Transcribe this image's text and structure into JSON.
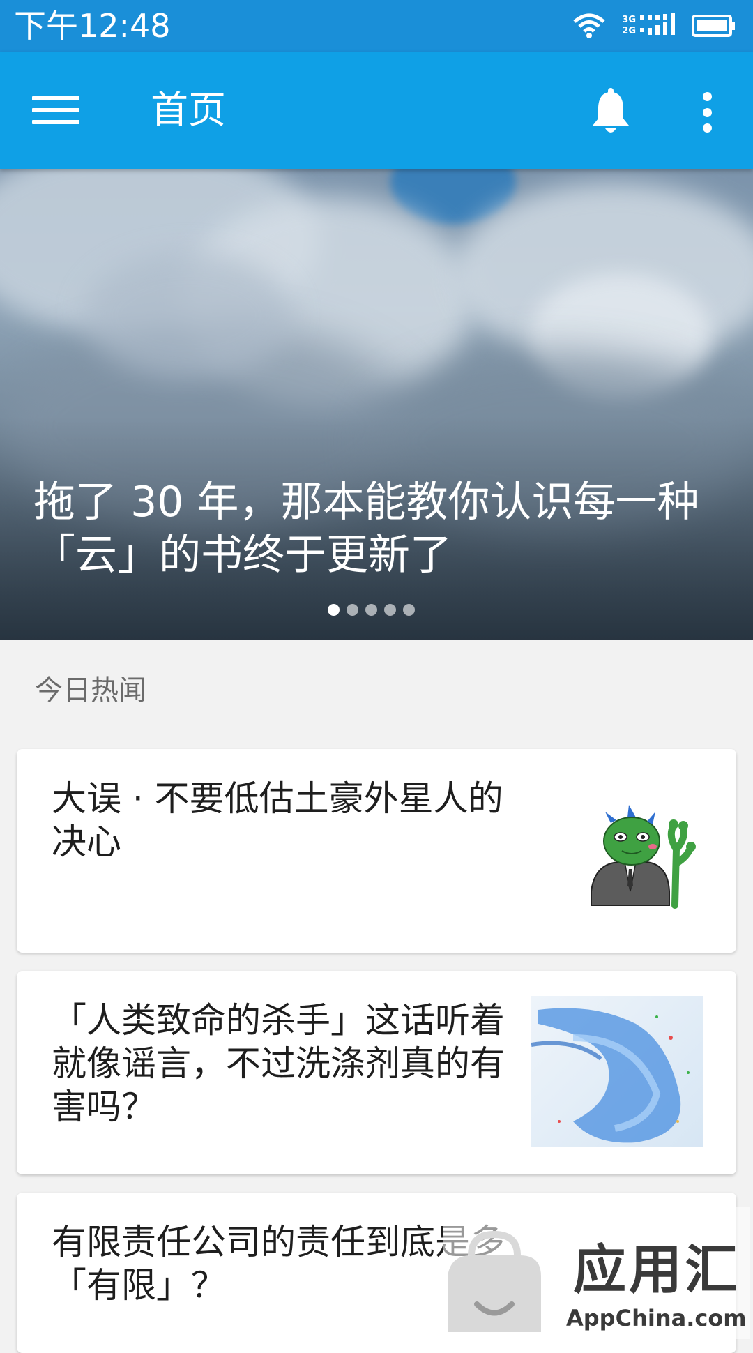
{
  "status_bar": {
    "time": "下午12:48",
    "network_labels": [
      "3G",
      "2G"
    ]
  },
  "toolbar": {
    "title": "首页",
    "menu_icon": "hamburger-menu-icon",
    "bell_icon": "bell-icon",
    "overflow_icon": "more-vert-icon"
  },
  "hero": {
    "headline": "拖了 30 年，那本能教你认识每一种「云」的书终于更新了",
    "slide_count": 5,
    "active_slide": 1
  },
  "section": {
    "title": "今日热闻"
  },
  "articles": [
    {
      "title": "大误 · 不要低估土豪外星人的决心"
    },
    {
      "title": "「人类致命的杀手」这话听着就像谣言，不过洗涤剂真的有害吗？"
    },
    {
      "title": "有限责任公司的责任到底是多「有限」？"
    }
  ],
  "watermark": {
    "brand": "应用汇",
    "domain": "AppChina.com"
  },
  "colors": {
    "status_bar": "#1a8fd8",
    "toolbar": "#0fa0e6",
    "background": "#f2f2f2"
  }
}
